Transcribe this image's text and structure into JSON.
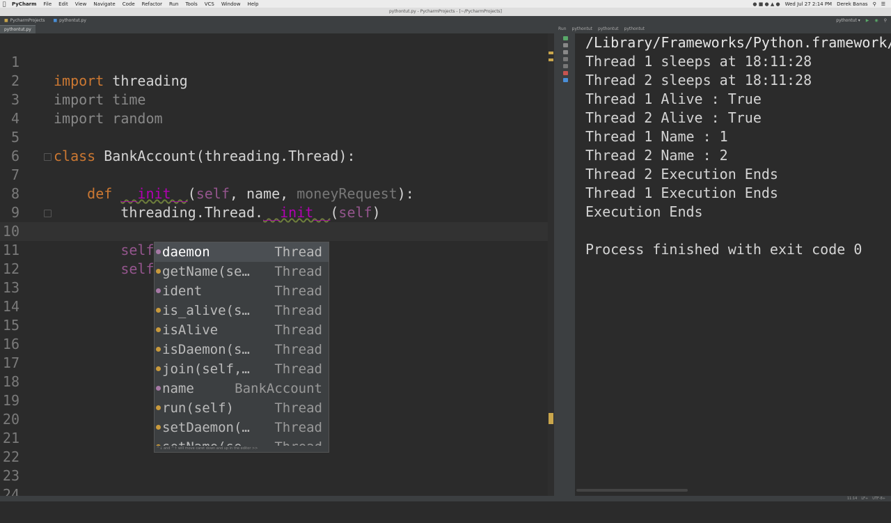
{
  "menubar": {
    "apple": "",
    "app_name": "PyCharm",
    "items": [
      "File",
      "Edit",
      "View",
      "Navigate",
      "Code",
      "Refactor",
      "Run",
      "Tools",
      "VCS",
      "Window",
      "Help"
    ],
    "clock": "Wed Jul 27  2:14 PM",
    "user": "Derek Banas"
  },
  "window": {
    "title": "pythontut.py - PycharmProjects - [~/PycharmProjects]"
  },
  "navbar": {
    "project": "PycharmProjects",
    "file": "pythontut.py",
    "run_config": "pythontut"
  },
  "tabs": [
    {
      "label": "pythontut.py"
    }
  ],
  "editor": {
    "lines": [
      {
        "num": "1",
        "code": "import threading"
      },
      {
        "num": "2",
        "code": "import time"
      },
      {
        "num": "3",
        "code": "import random"
      },
      {
        "num": "4",
        "code": ""
      },
      {
        "num": "5",
        "code": "class BankAccount(threading.Thread):"
      },
      {
        "num": "6",
        "code": ""
      },
      {
        "num": "7",
        "code": "    def __init__(self, name, moneyRequest):"
      },
      {
        "num": "8",
        "code": "        threading.Thread.__init__(self)"
      },
      {
        "num": "9",
        "code": ""
      },
      {
        "num": "10",
        "code": "        self.name = name"
      },
      {
        "num": "11",
        "code": "        self."
      },
      {
        "num": "12",
        "code": ""
      },
      {
        "num": "13",
        "code": ""
      },
      {
        "num": "14",
        "code": ""
      },
      {
        "num": "15",
        "code": ""
      },
      {
        "num": "16",
        "code": ""
      },
      {
        "num": "17",
        "code": ""
      },
      {
        "num": "18",
        "code": ""
      },
      {
        "num": "19",
        "code": ""
      },
      {
        "num": "20",
        "code": ""
      },
      {
        "num": "21",
        "code": ""
      },
      {
        "num": "22",
        "code": ""
      },
      {
        "num": "23",
        "code": ""
      },
      {
        "num": "24",
        "code": ""
      }
    ]
  },
  "completion": {
    "items": [
      {
        "name": "daemon",
        "type": "Thread",
        "kind": "field"
      },
      {
        "name": "getName(se…",
        "type": "Thread",
        "kind": "method"
      },
      {
        "name": "ident",
        "type": "Thread",
        "kind": "field"
      },
      {
        "name": "is_alive(s…",
        "type": "Thread",
        "kind": "method"
      },
      {
        "name": "isAlive",
        "type": "Thread",
        "kind": "method"
      },
      {
        "name": "isDaemon(s…",
        "type": "Thread",
        "kind": "method"
      },
      {
        "name": "join(self,…",
        "type": "Thread",
        "kind": "method"
      },
      {
        "name": "name",
        "type": "BankAccount",
        "kind": "field"
      },
      {
        "name": "run(self)",
        "type": "Thread",
        "kind": "method"
      },
      {
        "name": "setDaemon(…",
        "type": "Thread",
        "kind": "method"
      },
      {
        "name": "setName(se…",
        "type": "Thread",
        "kind": "method"
      }
    ],
    "footer": "^↓ and ^↑ will move caret down and up in the editor  >>"
  },
  "run_panel": {
    "header_label": "Run",
    "header_tabs": [
      "pythontut",
      "pythontut",
      "pythontut"
    ]
  },
  "console": {
    "lines": [
      "/Library/Frameworks/Python.framework/",
      "Thread 1 sleeps at 18:11:28",
      "Thread 2 sleeps at 18:11:28",
      "Thread 1 Alive : True",
      "Thread 2 Alive : True",
      "Thread 1 Name : 1",
      "Thread 2 Name : 2",
      "Thread 2 Execution Ends",
      "Thread 1 Execution Ends",
      "Execution Ends",
      "",
      "Process finished with exit code 0"
    ]
  },
  "statusbar": {
    "position": "11:14",
    "line_sep": "LF÷",
    "encoding": "UTF-8÷"
  }
}
